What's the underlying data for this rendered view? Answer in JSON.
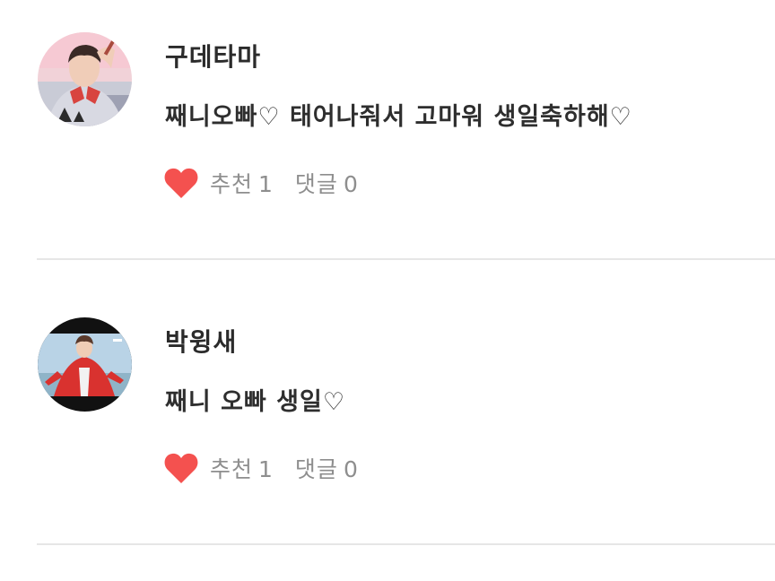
{
  "comments": [
    {
      "author": "구데타마",
      "text": "째니오빠♡ 태어나줘서 고마워 생일축하해♡",
      "like_label": "추천",
      "like_count": "1",
      "reply_label": "댓글",
      "reply_count": "0"
    },
    {
      "author": "박윙새",
      "text": "째니 오빠 생일♡",
      "like_label": "추천",
      "like_count": "1",
      "reply_label": "댓글",
      "reply_count": "0"
    }
  ],
  "colors": {
    "heart": "#f4514f",
    "meta_text": "#8e8e8e",
    "body_text": "#2e2e2e",
    "divider": "#e6e6e6"
  },
  "icons": {
    "like": "heart-icon"
  }
}
